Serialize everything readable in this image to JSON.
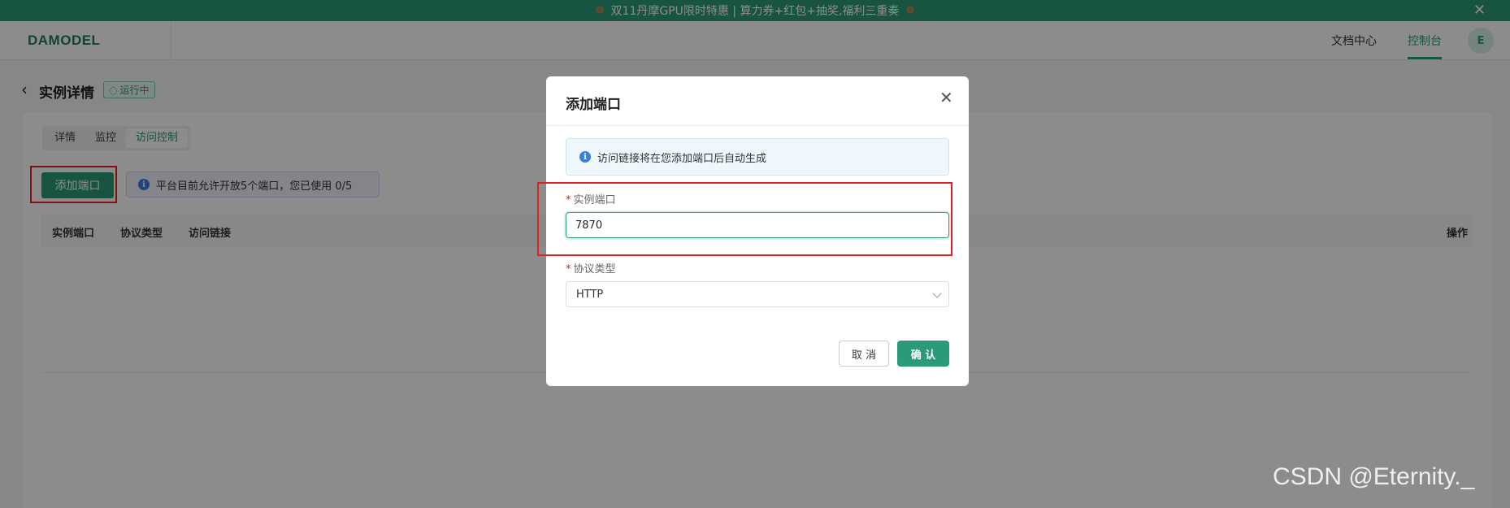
{
  "banner": {
    "text": "双11丹摩GPU限时特惠 | 算力券+红包+抽奖,福利三重奏",
    "spark_left": "❁",
    "spark_right": "❁",
    "close": "✕"
  },
  "navbar": {
    "logo": "DAMODEL",
    "docs": "文档中心",
    "console": "控制台",
    "avatar": "E"
  },
  "page": {
    "back": "‹",
    "title": "实例详情",
    "status": "运行中",
    "status_icon": "◌"
  },
  "tabs": [
    {
      "label": "详情"
    },
    {
      "label": "监控"
    },
    {
      "label": "访问控制"
    }
  ],
  "toolbar": {
    "add_port": "添加端口",
    "port_limit_info": "平台目前允许开放5个端口，您已使用 0/5",
    "info_icon": "i"
  },
  "table": {
    "columns": [
      "实例端口",
      "协议类型",
      "访问链接"
    ],
    "actions_column": "操作"
  },
  "modal": {
    "title": "添加端口",
    "close": "✕",
    "info": "访问链接将在您添加端口后自动生成",
    "port_label": "实例端口",
    "port_value": "7870",
    "protocol_label": "协议类型",
    "protocol_value": "HTTP",
    "required_mark": "*",
    "cancel": "取 消",
    "confirm": "确 认"
  },
  "watermark": "CSDN @Eternity._",
  "colors": {
    "brand": "#2a9a78",
    "highlight": "#e02020",
    "info": "#3b7ee0"
  }
}
